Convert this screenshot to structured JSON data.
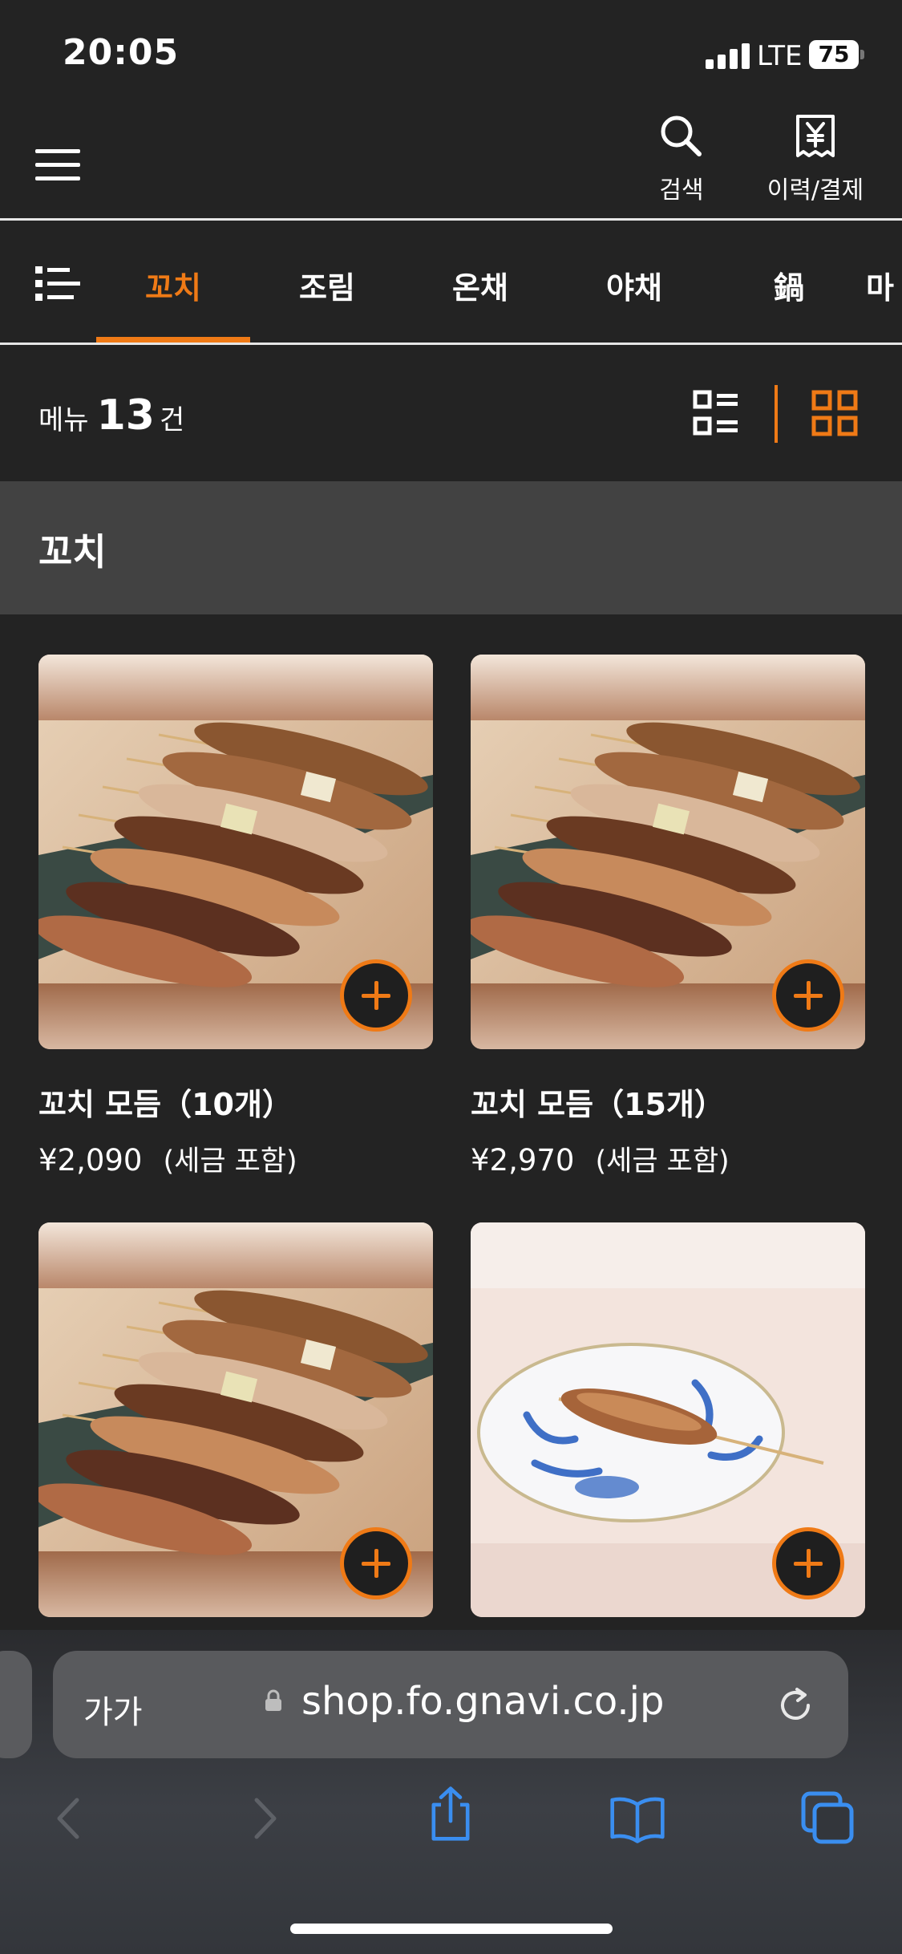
{
  "status_bar": {
    "time": "20:05",
    "network": "LTE",
    "battery": "75"
  },
  "header": {
    "menu_icon": "hamburger-menu-icon",
    "search_label": "검색",
    "history_label": "이력/결제"
  },
  "tabs": {
    "items": [
      {
        "label": "꼬치",
        "active": true
      },
      {
        "label": "조림",
        "active": false
      },
      {
        "label": "온채",
        "active": false
      },
      {
        "label": "야채",
        "active": false
      },
      {
        "label": "鍋",
        "active": false
      },
      {
        "label": "마",
        "active": false
      }
    ]
  },
  "count_bar": {
    "prefix": "메뉴",
    "count": "13",
    "suffix": "건",
    "active_view": "grid"
  },
  "section": {
    "title": "꼬치"
  },
  "items": [
    {
      "name": "꼬치 모듬（10개）",
      "price": "¥2,090",
      "tax": "(세금 포함)",
      "image": "yakitori-assortment"
    },
    {
      "name": "꼬치 모듬（15개）",
      "price": "¥2,970",
      "tax": "(세금 포함)",
      "image": "yakitori-assortment"
    },
    {
      "name": "",
      "price": "",
      "tax": "",
      "image": "yakitori-assortment"
    },
    {
      "name": "",
      "price": "",
      "tax": "",
      "image": "single-skewer-plate"
    }
  ],
  "browser": {
    "aa_label": "가가",
    "url": "shop.fo.gnavi.co.jp"
  },
  "colors": {
    "accent": "#ef7a16",
    "background": "#232323",
    "section_bg": "#424242",
    "safari_blue": "#3a8ef0"
  }
}
